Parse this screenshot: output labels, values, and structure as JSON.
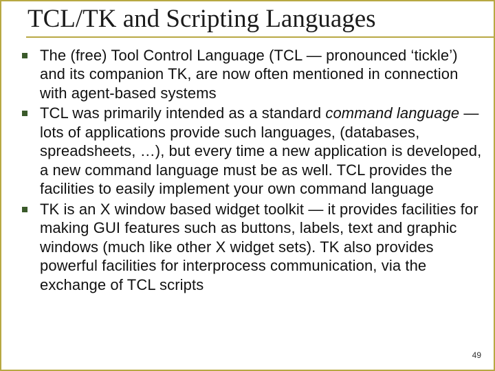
{
  "title": "TCL/TK and Scripting Languages",
  "bullets": [
    {
      "pre": "The (free) Tool Control Language (TCL — pronounced ‘tickle’) and its companion TK, are now often mentioned in connection with agent-based systems",
      "italic": "",
      "post": ""
    },
    {
      "pre": "TCL was primarily intended as a standard ",
      "italic": "command language",
      "post": " — lots of applications provide such languages, (databases, spreadsheets, …), but every time a new application is developed, a new command language must be as well. TCL provides the facilities to easily implement your own command language"
    },
    {
      "pre": "TK is an X window based widget toolkit — it provides facilities for making GUI features such as buttons, labels, text and graphic windows (much like other X widget sets). TK also provides powerful facilities for interprocess communication, via the exchange of TCL scripts",
      "italic": "",
      "post": ""
    }
  ],
  "page_number": "49"
}
